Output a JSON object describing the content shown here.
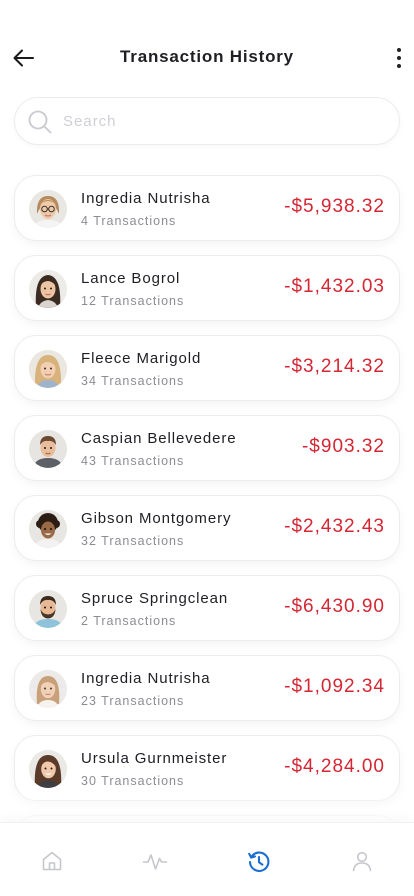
{
  "header": {
    "title": "Transaction History"
  },
  "search": {
    "placeholder": "Search"
  },
  "transactions": [
    {
      "name": "Ingredia Nutrisha",
      "count": "4 Transactions",
      "amount": "-$5,938.32",
      "avatar": "avatar-woman-glasses"
    },
    {
      "name": "Lance Bogrol",
      "count": "12 Transactions",
      "amount": "-$1,432.03",
      "avatar": "avatar-woman-dark-hair"
    },
    {
      "name": "Fleece Marigold",
      "count": "34 Transactions",
      "amount": "-$3,214.32",
      "avatar": "avatar-woman-blonde"
    },
    {
      "name": "Caspian Bellevedere",
      "count": "43 Transactions",
      "amount": "-$903.32",
      "avatar": "avatar-man-short-hair"
    },
    {
      "name": "Gibson Montgomery",
      "count": "32 Transactions",
      "amount": "-$2,432.43",
      "avatar": "avatar-man-curly-hair"
    },
    {
      "name": "Spruce Springclean",
      "count": "2 Transactions",
      "amount": "-$6,430.90",
      "avatar": "avatar-man-beard"
    },
    {
      "name": "Ingredia Nutrisha",
      "count": "23 Transactions",
      "amount": "-$1,092.34",
      "avatar": "avatar-woman-light-hair"
    },
    {
      "name": "Ursula Gurnmeister",
      "count": "30 Transactions",
      "amount": "-$4,284.00",
      "avatar": "avatar-woman-brown-hair"
    }
  ],
  "tabbar": {
    "active_tab": "history",
    "tabs": [
      {
        "id": "home",
        "icon": "home-icon"
      },
      {
        "id": "activity",
        "icon": "activity-icon"
      },
      {
        "id": "history",
        "icon": "history-icon"
      },
      {
        "id": "profile",
        "icon": "profile-icon"
      }
    ]
  },
  "colors": {
    "amount_negative": "#d42633",
    "active_tab": "#1a6fd1",
    "inactive_tab": "#c6c7cc"
  }
}
